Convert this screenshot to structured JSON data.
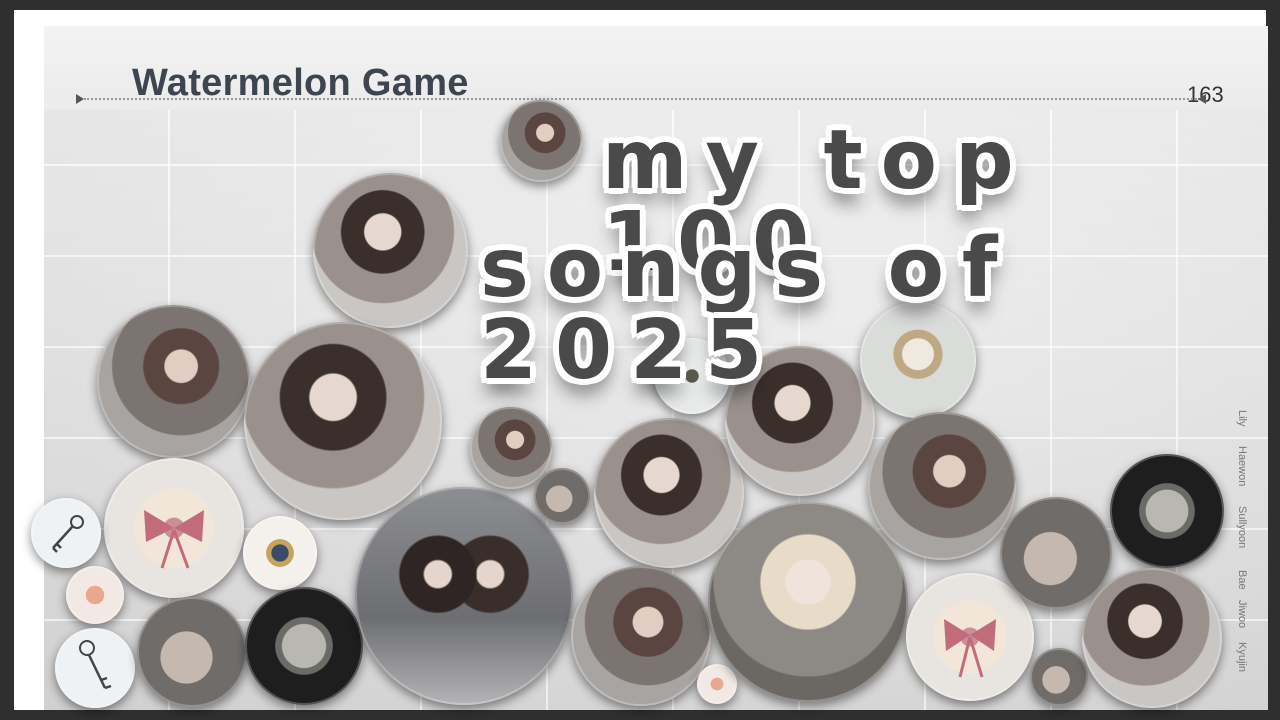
{
  "game": {
    "title": "Watermelon Game",
    "score": "163"
  },
  "headline": {
    "line1": "my top 100",
    "line2": "songs of 2025"
  },
  "members": [
    "Lily",
    "Haewon",
    "Sullyoon",
    "Bae",
    "Jiwoo",
    "Kyujin"
  ],
  "colors": {
    "frame": "#2f2f2f",
    "title_text": "#3d4550",
    "headline_fill": "#4a4a4a",
    "headline_outline": "#ffffff"
  }
}
